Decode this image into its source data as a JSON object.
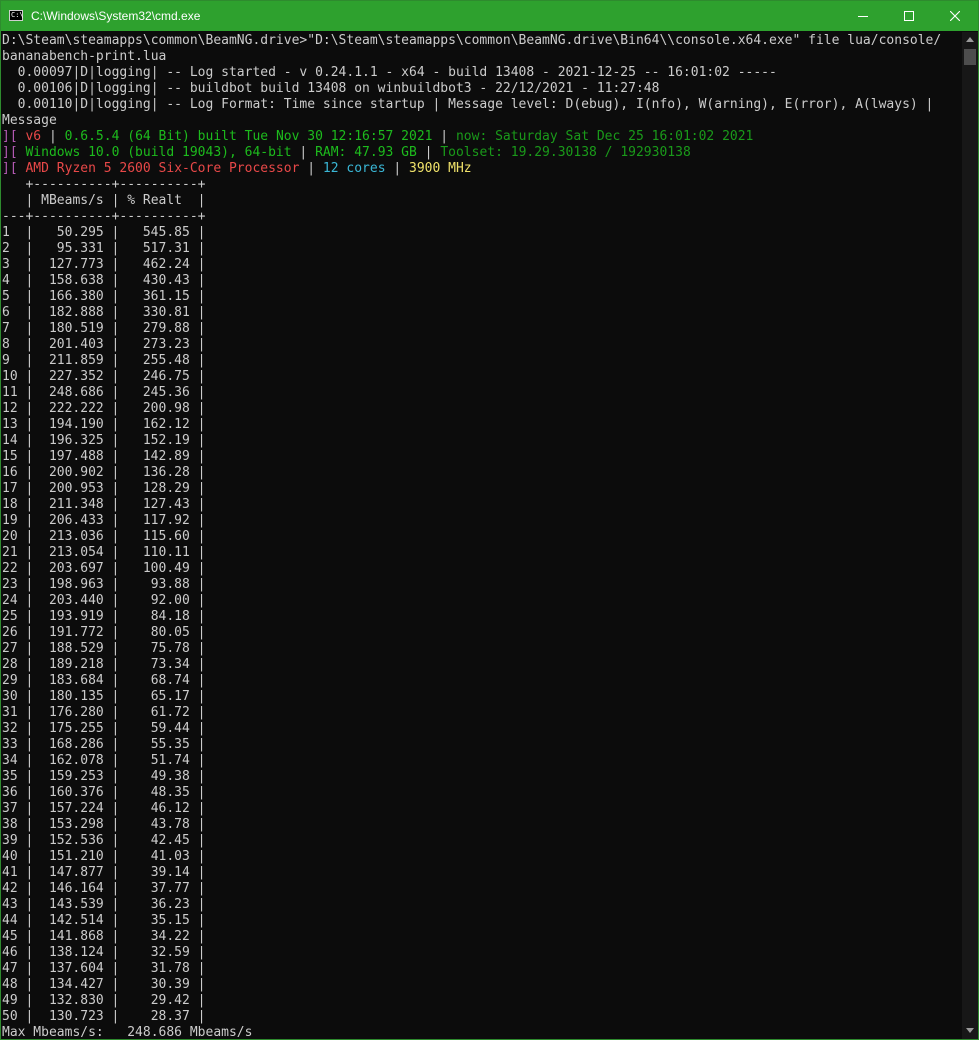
{
  "window": {
    "title": "C:\\Windows\\System32\\cmd.exe",
    "icon_label": "C:\\"
  },
  "console": {
    "command": [
      "D:\\Steam\\steamapps\\common\\BeamNG.drive>\"D:\\Steam\\steamapps\\common\\BeamNG.drive\\Bin64\\\\console.x64.exe\" file lua/console/",
      "bananabench-print.lua"
    ],
    "log_lines": [
      "  0.00097|D|logging| -- Log started - v 0.24.1.1 - x64 - build 13408 - 2021-12-25 -- 16:01:02 -----",
      "  0.00106|D|logging| -- buildbot build 13408 on winbuildbot3 - 22/12/2021 - 11:27:48",
      "  0.00110|D|logging| -- Log Format: Time since startup | Message level: D(ebug), I(nfo), W(arning), E(rror), A(lways) |",
      "Message"
    ],
    "info_line_1": {
      "prefix": "][",
      "version": " v6",
      "sep1": " | ",
      "build": "0.6.5.4 (64 Bit) built Tue Nov 30 12:16:57 2021",
      "sep2": " | ",
      "now": "now: Saturday Sat Dec 25 16:01:02 2021"
    },
    "info_line_2": {
      "prefix": "][",
      "os": " Windows 10.0 (build 19043), 64-bit",
      "sep1": " | ",
      "ram": "RAM: 47.93 GB",
      "sep2": " | ",
      "toolset": "Toolset: 19.29.30138 / 192930138"
    },
    "info_line_3": {
      "prefix": "][",
      "cpu": " AMD Ryzen 5 2600 Six-Core Processor",
      "sep1": " | ",
      "cores": "12 cores",
      "sep2": " | ",
      "mhz": "3900 MHz"
    },
    "table_lines": [
      "   +----------+----------+",
      "   | MBeams/s | % Realt  |",
      "---+----------+----------+"
    ],
    "table_rows": [
      {
        "n": "1",
        "mbeams": "50.295",
        "realt": "545.85"
      },
      {
        "n": "2",
        "mbeams": "95.331",
        "realt": "517.31"
      },
      {
        "n": "3",
        "mbeams": "127.773",
        "realt": "462.24"
      },
      {
        "n": "4",
        "mbeams": "158.638",
        "realt": "430.43"
      },
      {
        "n": "5",
        "mbeams": "166.380",
        "realt": "361.15"
      },
      {
        "n": "6",
        "mbeams": "182.888",
        "realt": "330.81"
      },
      {
        "n": "7",
        "mbeams": "180.519",
        "realt": "279.88"
      },
      {
        "n": "8",
        "mbeams": "201.403",
        "realt": "273.23"
      },
      {
        "n": "9",
        "mbeams": "211.859",
        "realt": "255.48"
      },
      {
        "n": "10",
        "mbeams": "227.352",
        "realt": "246.75"
      },
      {
        "n": "11",
        "mbeams": "248.686",
        "realt": "245.36"
      },
      {
        "n": "12",
        "mbeams": "222.222",
        "realt": "200.98"
      },
      {
        "n": "13",
        "mbeams": "194.190",
        "realt": "162.12"
      },
      {
        "n": "14",
        "mbeams": "196.325",
        "realt": "152.19"
      },
      {
        "n": "15",
        "mbeams": "197.488",
        "realt": "142.89"
      },
      {
        "n": "16",
        "mbeams": "200.902",
        "realt": "136.28"
      },
      {
        "n": "17",
        "mbeams": "200.953",
        "realt": "128.29"
      },
      {
        "n": "18",
        "mbeams": "211.348",
        "realt": "127.43"
      },
      {
        "n": "19",
        "mbeams": "206.433",
        "realt": "117.92"
      },
      {
        "n": "20",
        "mbeams": "213.036",
        "realt": "115.60"
      },
      {
        "n": "21",
        "mbeams": "213.054",
        "realt": "110.11"
      },
      {
        "n": "22",
        "mbeams": "203.697",
        "realt": "100.49"
      },
      {
        "n": "23",
        "mbeams": "198.963",
        "realt": "93.88"
      },
      {
        "n": "24",
        "mbeams": "203.440",
        "realt": "92.00"
      },
      {
        "n": "25",
        "mbeams": "193.919",
        "realt": "84.18"
      },
      {
        "n": "26",
        "mbeams": "191.772",
        "realt": "80.05"
      },
      {
        "n": "27",
        "mbeams": "188.529",
        "realt": "75.78"
      },
      {
        "n": "28",
        "mbeams": "189.218",
        "realt": "73.34"
      },
      {
        "n": "29",
        "mbeams": "183.684",
        "realt": "68.74"
      },
      {
        "n": "30",
        "mbeams": "180.135",
        "realt": "65.17"
      },
      {
        "n": "31",
        "mbeams": "176.280",
        "realt": "61.72"
      },
      {
        "n": "32",
        "mbeams": "175.255",
        "realt": "59.44"
      },
      {
        "n": "33",
        "mbeams": "168.286",
        "realt": "55.35"
      },
      {
        "n": "34",
        "mbeams": "162.078",
        "realt": "51.74"
      },
      {
        "n": "35",
        "mbeams": "159.253",
        "realt": "49.38"
      },
      {
        "n": "36",
        "mbeams": "160.376",
        "realt": "48.35"
      },
      {
        "n": "37",
        "mbeams": "157.224",
        "realt": "46.12"
      },
      {
        "n": "38",
        "mbeams": "153.298",
        "realt": "43.78"
      },
      {
        "n": "39",
        "mbeams": "152.536",
        "realt": "42.45"
      },
      {
        "n": "40",
        "mbeams": "151.210",
        "realt": "41.03"
      },
      {
        "n": "41",
        "mbeams": "147.877",
        "realt": "39.14"
      },
      {
        "n": "42",
        "mbeams": "146.164",
        "realt": "37.77"
      },
      {
        "n": "43",
        "mbeams": "143.539",
        "realt": "36.23"
      },
      {
        "n": "44",
        "mbeams": "142.514",
        "realt": "35.15"
      },
      {
        "n": "45",
        "mbeams": "141.868",
        "realt": "34.22"
      },
      {
        "n": "46",
        "mbeams": "138.124",
        "realt": "32.59"
      },
      {
        "n": "47",
        "mbeams": "137.604",
        "realt": "31.78"
      },
      {
        "n": "48",
        "mbeams": "134.427",
        "realt": "30.39"
      },
      {
        "n": "49",
        "mbeams": "132.830",
        "realt": "29.42"
      },
      {
        "n": "50",
        "mbeams": "130.723",
        "realt": "28.37"
      }
    ],
    "summary": "Max Mbeams/s:   248.686 Mbeams/s"
  },
  "colors": {
    "titlebar": "#2ea12e",
    "background": "#0c0c0c",
    "text": "#cccccc",
    "red": "#e84848",
    "green": "#1dbb1d",
    "cyan": "#3ab7d6",
    "yellow": "#f0e26a"
  },
  "icons": [
    "cmd-app-icon",
    "minimize-icon",
    "maximize-icon",
    "close-icon",
    "scroll-up-arrow-icon",
    "scroll-down-arrow-icon"
  ]
}
